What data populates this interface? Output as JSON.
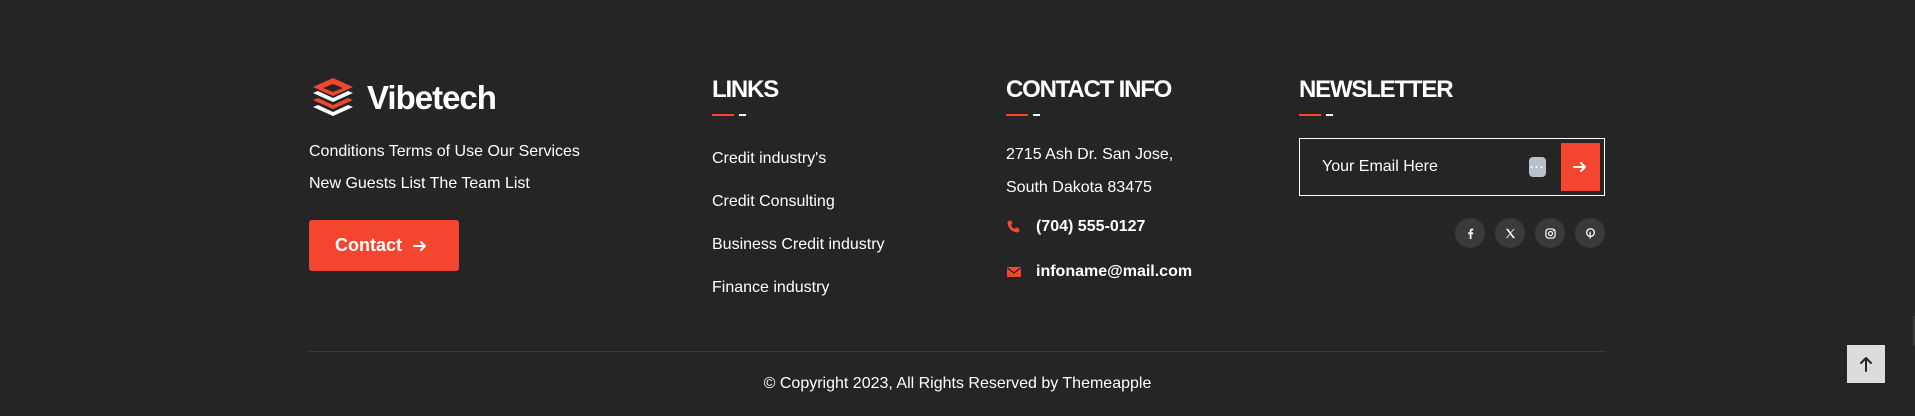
{
  "brand": {
    "name": "Vibetech",
    "lines": [
      "Conditions Terms of Use Our Services",
      "New Guests List The Team List"
    ],
    "contact_button": "Contact",
    "logo_icon": "layered-stack-logo-icon"
  },
  "links": {
    "heading": "LINKS",
    "items": [
      "Credit industry's",
      "Credit Consulting",
      "Business Credit industry",
      "Finance industry"
    ]
  },
  "contact_info": {
    "heading": "CONTACT INFO",
    "address_line1": "2715 Ash Dr. San Jose,",
    "address_line2": "South Dakota 83475",
    "phone": "(704) 555-0127",
    "email": "infoname@mail.com",
    "phone_icon": "phone-icon",
    "email_icon": "envelope-icon"
  },
  "newsletter": {
    "heading": "NEWSLETTER",
    "placeholder": "Your Email Here",
    "badge": "···",
    "submit_icon": "arrow-right-icon",
    "social": [
      "facebook-icon",
      "x-twitter-icon",
      "instagram-icon",
      "pinterest-icon"
    ]
  },
  "footer": {
    "copyright": "© Copyright 2023, All Rights Reserved by Themeapple",
    "scroll_top_icon": "arrow-up-icon"
  },
  "colors": {
    "background": "#252525",
    "accent": "#f4462f",
    "text": "#ffffff"
  }
}
